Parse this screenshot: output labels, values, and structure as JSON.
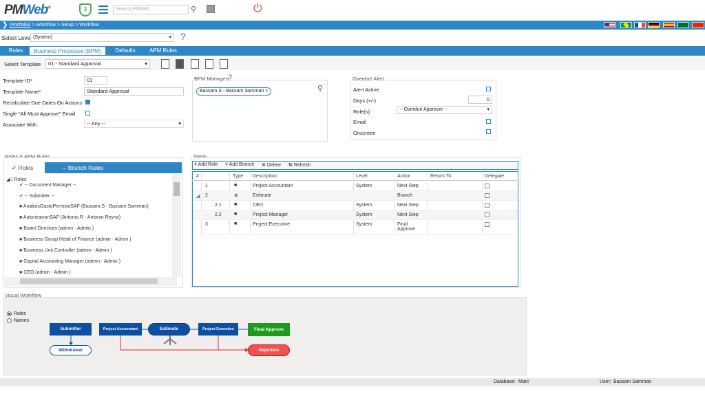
{
  "header": {
    "logo_text": "PM",
    "logo_text2": "Web",
    "logo_tm": "®",
    "shield_count": "3",
    "search_placeholder": "Search PMWeb..."
  },
  "breadcrumb": {
    "link": "(Portfolio)",
    "rest": " > Workflow > Setup > Workflow"
  },
  "level": {
    "label": "Select Level",
    "value": "(System)",
    "help": "?"
  },
  "tabs": [
    {
      "label": "Roles"
    },
    {
      "label": "Business Processes (BPM)"
    },
    {
      "label": "Defaults"
    },
    {
      "label": "APM Rules"
    }
  ],
  "template": {
    "label": "Select Template",
    "value": "01 - Standard Approval"
  },
  "form": {
    "id_label": "Template ID*",
    "id_value": "01",
    "name_label": "Template Name*",
    "name_value": "Standard Approval",
    "recalc_label": "Recalculate Due Dates On Actions",
    "single_label": "Single \"All Must Approve\" Email",
    "assoc_label": "Associate With",
    "assoc_value": "-- Any --"
  },
  "bpm": {
    "title": "BPM Managers",
    "help": "?",
    "chip": "Bassam.S - Bassam Samman",
    "chip_x": "×"
  },
  "overdue": {
    "title": "Overdue Alert",
    "alert_label": "Alert Active",
    "days_label": "Days (+/-)",
    "days_value": "0",
    "roles_label": "Role(s)",
    "roles_value": "-- Overdue Approver --",
    "email_label": "Email",
    "onscreen_label": "Onscreen"
  },
  "roles_panel": {
    "title": "Roles & APM Rules",
    "tab_roles": "Roles",
    "tab_branch": "Branch Rules",
    "root": "Roles",
    "items": [
      "-- Document Manager --",
      "-- Submitter --",
      "AnalisisGastoPermisoSAF (Bassam.S - Bassam Samman)",
      "AutorizacionSAF (Antonio.R - Antonio Reyna)",
      "Board Directors (admin - Admin )",
      "Business Group Head of Finance (admin - Admin )",
      "Business Unit Controller (admin - Admin )",
      "Capital Accounting Manager (admin - Admin )",
      "CEO (admin - Admin )"
    ]
  },
  "steps": {
    "title": "Steps",
    "add_role": "Add Role",
    "add_branch": "Add Branch",
    "delete": "Delete",
    "refresh": "Refresh",
    "columns": [
      "#",
      "Type",
      "Description",
      "Level",
      "Action",
      "Return To",
      "Delegate"
    ],
    "rows": [
      {
        "num": "1",
        "desc": "Project Accountant",
        "level": "System",
        "action": "Next Step"
      },
      {
        "num": "2",
        "desc": "Estimate",
        "level": "",
        "action": "Branch"
      },
      {
        "num": "2.1",
        "desc": "CEO",
        "level": "System",
        "action": "Next Step"
      },
      {
        "num": "2.2",
        "desc": "Project Manager",
        "level": "System",
        "action": "Next Step"
      },
      {
        "num": "3",
        "desc": "Project Executive",
        "level": "System",
        "action": "Final Approve"
      }
    ]
  },
  "visual": {
    "title": "Visual Workflow",
    "opt_roles": "Roles",
    "opt_names": "Names",
    "nodes": {
      "submitter": "Submitter",
      "withdrawal": "Withdrawal",
      "accountant": "Project Accountant",
      "estimate": "Estimate",
      "executive": "Project Executive",
      "final": "Final Approve",
      "rejection": "Rejection"
    },
    "colors": {
      "blue": "#0d4fa3",
      "green": "#1f9a1f",
      "red": "#ef5350",
      "line_red": "#d32f2f"
    }
  },
  "footer": {
    "db_label": "Database:",
    "db_value": "Marc",
    "user_label": "User:",
    "user_value": "Bassam Samman"
  }
}
